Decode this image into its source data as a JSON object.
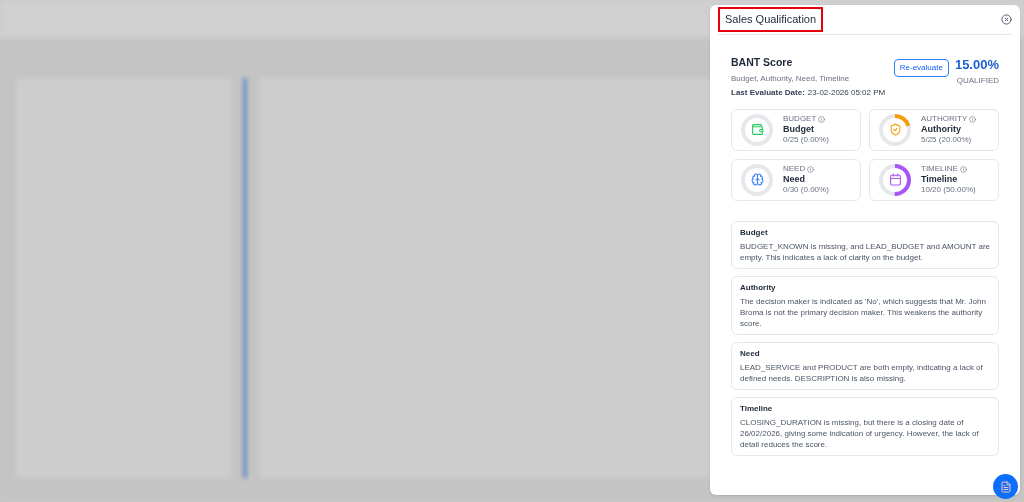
{
  "dialog": {
    "title": "Sales Qualification"
  },
  "bant": {
    "title": "BANT Score",
    "subtitle": "Budget, Authority, Need, Timeline",
    "date_label": "Last Evaluate Date:",
    "date": "23-02-2026 05:02 PM",
    "button": "Re-evaluate",
    "score": "15.00%",
    "score_label": "QUALIFIED"
  },
  "metrics": [
    {
      "kind": "budget",
      "caption": "BUDGET",
      "name": "Budget",
      "reading": "0/25 (0.00%)",
      "level": 0,
      "color": "#22c55e"
    },
    {
      "kind": "authority",
      "caption": "AUTHORITY",
      "name": "Authority",
      "reading": "5/25 (20.00%)",
      "level": 0.2,
      "color": "#f59e0b"
    },
    {
      "kind": "need",
      "caption": "NEED",
      "name": "Need",
      "reading": "0/30 (0.00%)",
      "level": 0,
      "color": "#3b82f6"
    },
    {
      "kind": "timeline",
      "caption": "TIMELINE",
      "name": "Timeline",
      "reading": "10/20 (50.00%)",
      "level": 0.5,
      "color": "#a855f7"
    }
  ],
  "notes": [
    {
      "title": "Budget",
      "text": "BUDGET_KNOWN is missing, and LEAD_BUDGET and AMOUNT are empty. This indicates a lack of clarity on the budget."
    },
    {
      "title": "Authority",
      "text": "The decision maker is indicated as 'No', which suggests that Mr. John Broma is not the primary decision maker. This weakens the authority score."
    },
    {
      "title": "Need",
      "text": "LEAD_SERVICE and PRODUCT are both empty, indicating a lack of defined needs. DESCRIPTION is also missing."
    },
    {
      "title": "Timeline",
      "text": "CLOSING_DURATION is missing, but there is a closing date of 26/02/2026, giving some indication of urgency. However, the lack of detail reduces the score."
    }
  ]
}
